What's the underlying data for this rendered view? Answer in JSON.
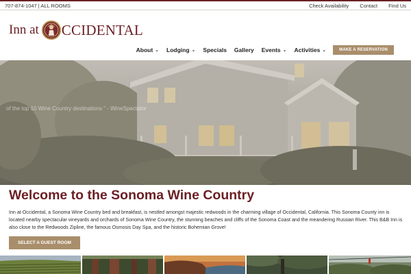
{
  "topbar": {
    "phone_rooms": "707-874-1047 | ALL ROOMS",
    "links": [
      "Check Availability",
      "Contact",
      "Find Us"
    ]
  },
  "logo": {
    "part1": "Inn at",
    "part2": "CCIDENTAL"
  },
  "nav": {
    "items": [
      {
        "label": "About",
        "dropdown": true
      },
      {
        "label": "Lodging",
        "dropdown": true
      },
      {
        "label": "Specials",
        "dropdown": false
      },
      {
        "label": "Gallery",
        "dropdown": false
      },
      {
        "label": "Events",
        "dropdown": true
      },
      {
        "label": "Activities",
        "dropdown": true
      }
    ],
    "reserve_label": "MAKE A RESERVATION"
  },
  "hero": {
    "caption": "of the top 10 Wine Country destinations \" - WineSpectator"
  },
  "content": {
    "title": "Welcome to the Sonoma Wine Country",
    "intro": "Inn at Occidental, a Sonoma Wine Country bed and breakfast, is nestled amongst majestic redwoods in the charming village of Occidental, California. This Sonoma County inn is located nearby spectacular vineyards and orchards of Sonoma Wine Country, the stunning beaches and cliffs of the Sonoma Coast and the meandering Russian River. This B&B Inn is also close to the Redwoods Zipline, the famous Osmosis Day Spa, and the historic Bohemian Grove!",
    "guest_button": "SELECT A GUEST ROOM"
  },
  "thumbnails": [
    "vineyard",
    "redwoods",
    "coast",
    "forest",
    "zipline"
  ],
  "colors": {
    "brand": "#6b1f24",
    "button": "#a98e6b",
    "text": "#2c2c2c"
  }
}
